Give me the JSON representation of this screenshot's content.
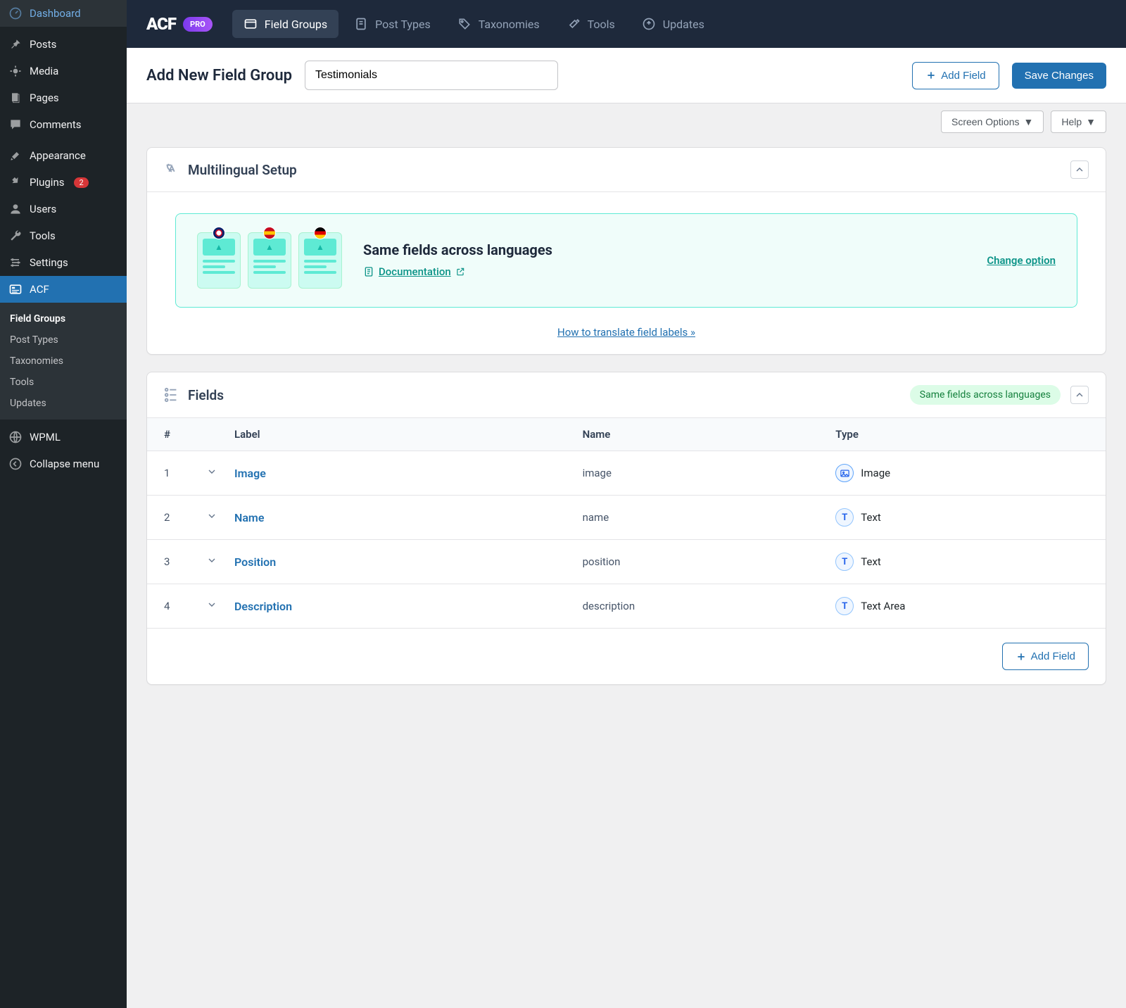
{
  "sidebar": {
    "items": [
      {
        "icon": "dashboard",
        "label": "Dashboard"
      },
      {
        "icon": "pin",
        "label": "Posts"
      },
      {
        "icon": "media",
        "label": "Media"
      },
      {
        "icon": "page",
        "label": "Pages"
      },
      {
        "icon": "comment",
        "label": "Comments"
      },
      {
        "icon": "brush",
        "label": "Appearance"
      },
      {
        "icon": "plugin",
        "label": "Plugins",
        "badge": "2"
      },
      {
        "icon": "user",
        "label": "Users"
      },
      {
        "icon": "wrench",
        "label": "Tools"
      },
      {
        "icon": "settings",
        "label": "Settings"
      },
      {
        "icon": "acf",
        "label": "ACF",
        "active": true
      }
    ],
    "sub": [
      {
        "label": "Field Groups",
        "active": true
      },
      {
        "label": "Post Types"
      },
      {
        "label": "Taxonomies"
      },
      {
        "label": "Tools"
      },
      {
        "label": "Updates"
      }
    ],
    "footer": [
      {
        "icon": "wpml",
        "label": "WPML"
      },
      {
        "icon": "collapse",
        "label": "Collapse menu"
      }
    ]
  },
  "topnav": {
    "logo": "ACF",
    "pro": "PRO",
    "items": [
      {
        "label": "Field Groups",
        "active": true
      },
      {
        "label": "Post Types"
      },
      {
        "label": "Taxonomies"
      },
      {
        "label": "Tools"
      },
      {
        "label": "Updates"
      }
    ]
  },
  "header": {
    "title": "Add New Field Group",
    "input_value": "Testimonials",
    "add_field": "Add Field",
    "save": "Save Changes"
  },
  "toolbar": {
    "screen_options": "Screen Options",
    "help": "Help"
  },
  "multilingual": {
    "section_title": "Multilingual Setup",
    "heading": "Same fields across languages",
    "documentation": "Documentation",
    "change_option": "Change option",
    "translate_link": "How to translate field labels »",
    "flags": [
      "uk",
      "es",
      "de"
    ]
  },
  "fields_panel": {
    "section_title": "Fields",
    "lang_pill": "Same fields across languages",
    "headers": {
      "num": "#",
      "label": "Label",
      "name": "Name",
      "type": "Type"
    },
    "rows": [
      {
        "num": "1",
        "label": "Image",
        "name": "image",
        "type_label": "Image",
        "type_icon": "image"
      },
      {
        "num": "2",
        "label": "Name",
        "name": "name",
        "type_label": "Text",
        "type_icon": "text"
      },
      {
        "num": "3",
        "label": "Position",
        "name": "position",
        "type_label": "Text",
        "type_icon": "text"
      },
      {
        "num": "4",
        "label": "Description",
        "name": "description",
        "type_label": "Text Area",
        "type_icon": "text"
      }
    ],
    "add_field": "Add Field"
  }
}
